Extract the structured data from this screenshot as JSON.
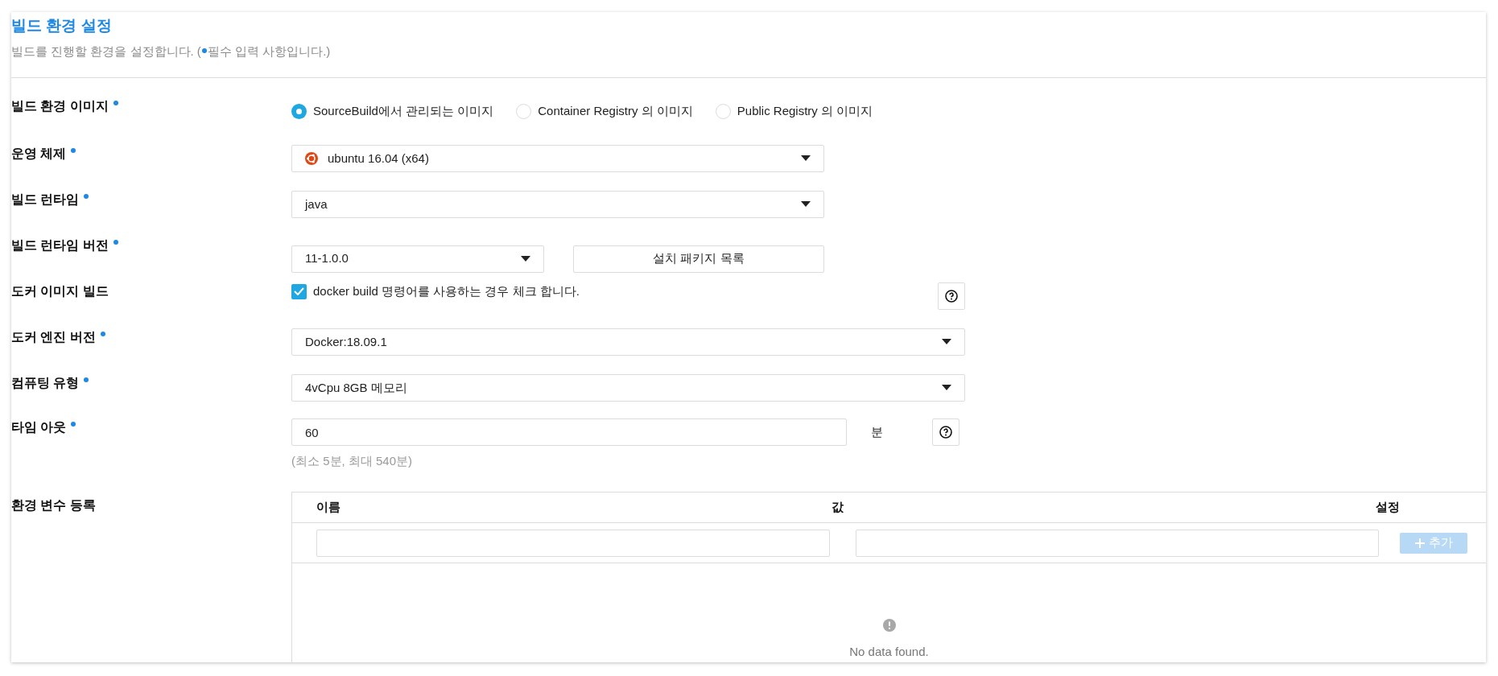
{
  "header": {
    "title": "빌드 환경 설정",
    "description_before": "빌드를 진행할 환경을 설정합니다. (",
    "description_after": "필수 입력 사항입니다.)"
  },
  "fields": [
    {
      "kind": "radio",
      "label": "빌드 환경 이미지",
      "required": true,
      "options": [
        {
          "label": "SourceBuild에서 관리되는 이미지",
          "selected": true
        },
        {
          "label": "Container Registry 의 이미지",
          "selected": false
        },
        {
          "label": "Public Registry 의 이미지",
          "selected": false
        }
      ]
    },
    {
      "kind": "select",
      "label": "운영 체제",
      "required": true,
      "value": "ubuntu 16.04 (x64)",
      "os_icon": true
    },
    {
      "kind": "select",
      "label": "빌드 런타임",
      "required": true,
      "value": "java"
    },
    {
      "kind": "select_button",
      "label": "빌드 런타임 버전",
      "required": true,
      "value": "11-1.0.0",
      "button": "설치 패키지 목록"
    },
    {
      "kind": "checkbox",
      "label": "도커 이미지 빌드",
      "required": false,
      "text": "docker build 명령어를 사용하는 경우 체크 합니다.",
      "checked": true,
      "help": true
    },
    {
      "kind": "wideselect",
      "label": "도커 엔진 버전",
      "required": true,
      "value": "Docker:18.09.1"
    },
    {
      "kind": "wideselect",
      "label": "컴퓨팅 유형",
      "required": true,
      "value": "4vCpu 8GB 메모리"
    },
    {
      "kind": "input",
      "label": "타임 아웃",
      "required": true,
      "value": "60",
      "unit": "분",
      "help": true,
      "hint": "(최소 5분, 최대 540분)"
    },
    {
      "kind": "table",
      "label": "환경 변수 등록",
      "required": false,
      "columns": [
        "이름",
        "값",
        "설정"
      ],
      "add_button": "추가",
      "add_disabled": true,
      "empty_text": "No data found."
    }
  ]
}
